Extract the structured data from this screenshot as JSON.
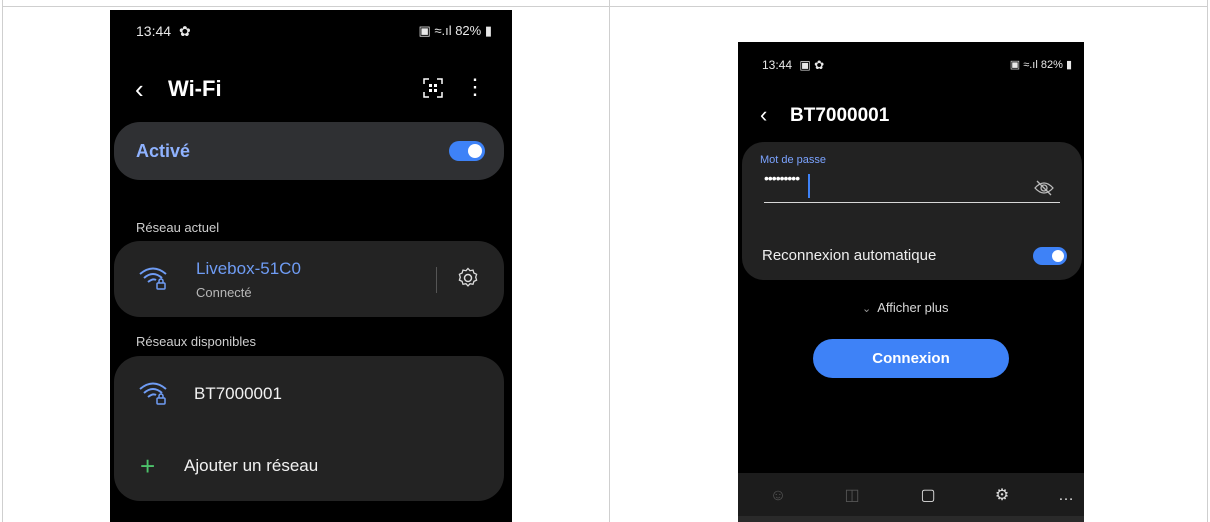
{
  "left_phone": {
    "status": {
      "time": "13:44",
      "battery": "82%"
    },
    "header": {
      "title": "Wi-Fi"
    },
    "active_row": {
      "label": "Activé",
      "toggle_on": true
    },
    "current_network_section": "Réseau actuel",
    "current_network": {
      "name": "Livebox-51C0",
      "status": "Connecté"
    },
    "available_section": "Réseaux disponibles",
    "available_networks": [
      {
        "name": "BT7000001"
      }
    ],
    "add_network_label": "Ajouter un réseau"
  },
  "right_phone": {
    "status": {
      "time": "13:44",
      "battery": "82%"
    },
    "header": {
      "title": "BT7000001"
    },
    "password": {
      "label": "Mot de passe",
      "value": "•••••••••"
    },
    "auto_reconnect": {
      "label": "Reconnexion automatique",
      "toggle_on": true
    },
    "show_more_label": "Afficher plus",
    "connect_button": "Connexion"
  },
  "colors": {
    "accent": "#3e82f7",
    "link_blue": "#6f9cf4",
    "card": "#232323",
    "add_plus": "#4cc36a"
  }
}
